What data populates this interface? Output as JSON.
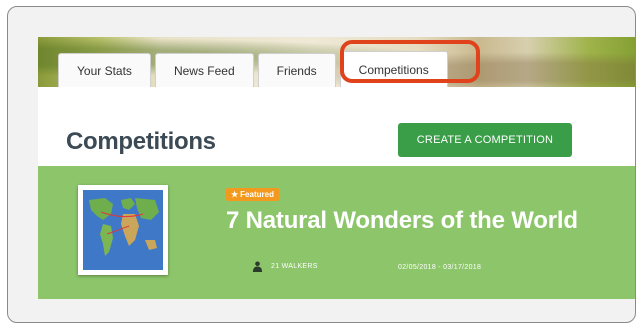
{
  "tabs": [
    {
      "label": "Your Stats",
      "active": false
    },
    {
      "label": "News Feed",
      "active": false
    },
    {
      "label": "Friends",
      "active": false
    },
    {
      "label": "Competitions",
      "active": true
    }
  ],
  "page": {
    "title": "Competitions",
    "create_button_label": "CREATE A COMPETITION"
  },
  "competition": {
    "badge_icon": "star-icon",
    "badge_label": "Featured",
    "title": "7 Natural Wonders of the World",
    "walkers_icon": "person-icon",
    "walkers_label": "21 WALKERS",
    "date_range": "02/05/2018 - 03/17/2018",
    "thumbnail_icon": "world-map-icon"
  },
  "colors": {
    "card_background": "#8cc56a",
    "create_button": "#3a9d48",
    "featured_badge": "#f39a1e",
    "highlight_outline": "#e0431c",
    "page_title": "#3b4a55"
  }
}
